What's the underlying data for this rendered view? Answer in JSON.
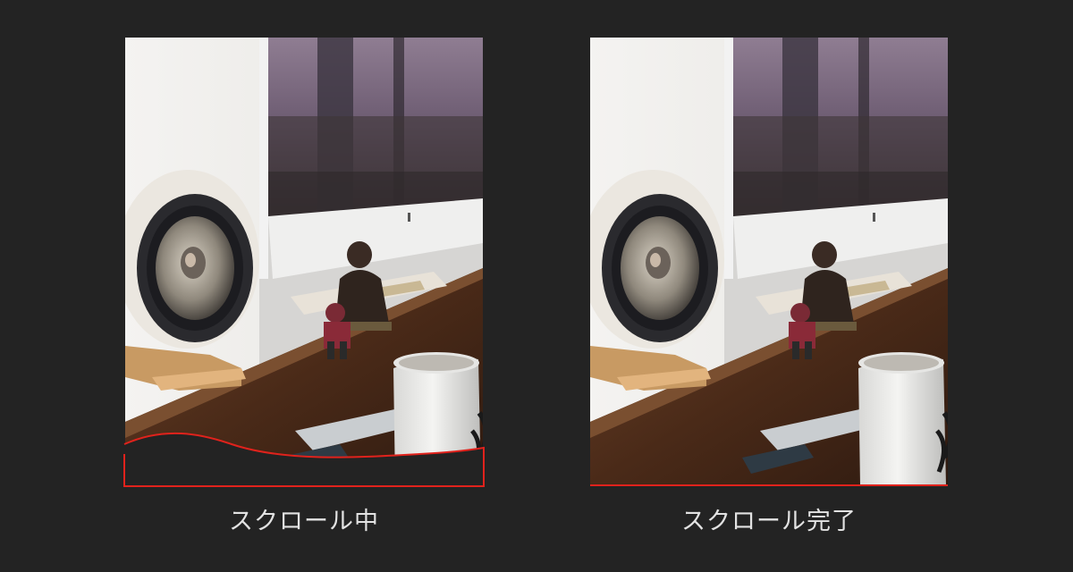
{
  "colors": {
    "background": "#232323",
    "accent_line": "#e0221c",
    "caption_text": "#e2e2e2"
  },
  "panels": [
    {
      "caption": "スクロール中",
      "state": "scrolling",
      "image_subject": "desk-speaker-photo"
    },
    {
      "caption": "スクロール完了",
      "state": "scroll-complete",
      "image_subject": "desk-speaker-photo"
    }
  ]
}
